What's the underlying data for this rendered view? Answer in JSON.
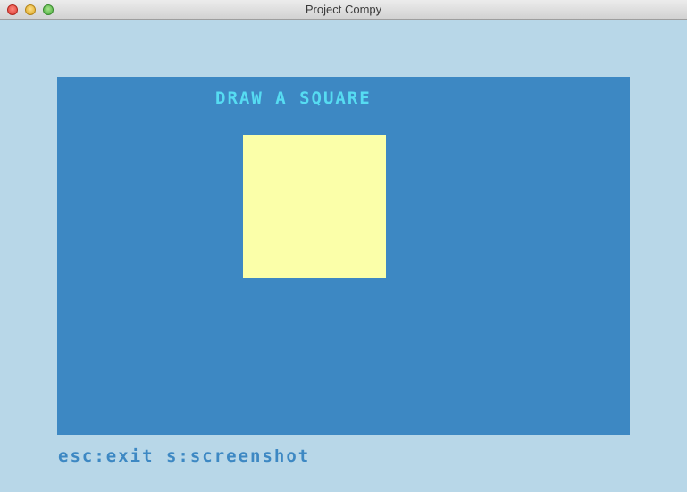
{
  "window": {
    "title": "Project Compy"
  },
  "screen": {
    "prompt": "DRAW A SQUARE",
    "square_color": "#fbffa9",
    "background_color": "#3d88c3",
    "prompt_color": "#56dcf2"
  },
  "status": {
    "text": "esc:exit s:screenshot"
  },
  "icons": {
    "close": "close-dot-icon",
    "minimize": "minimize-dot-icon",
    "maximize": "maximize-dot-icon"
  }
}
